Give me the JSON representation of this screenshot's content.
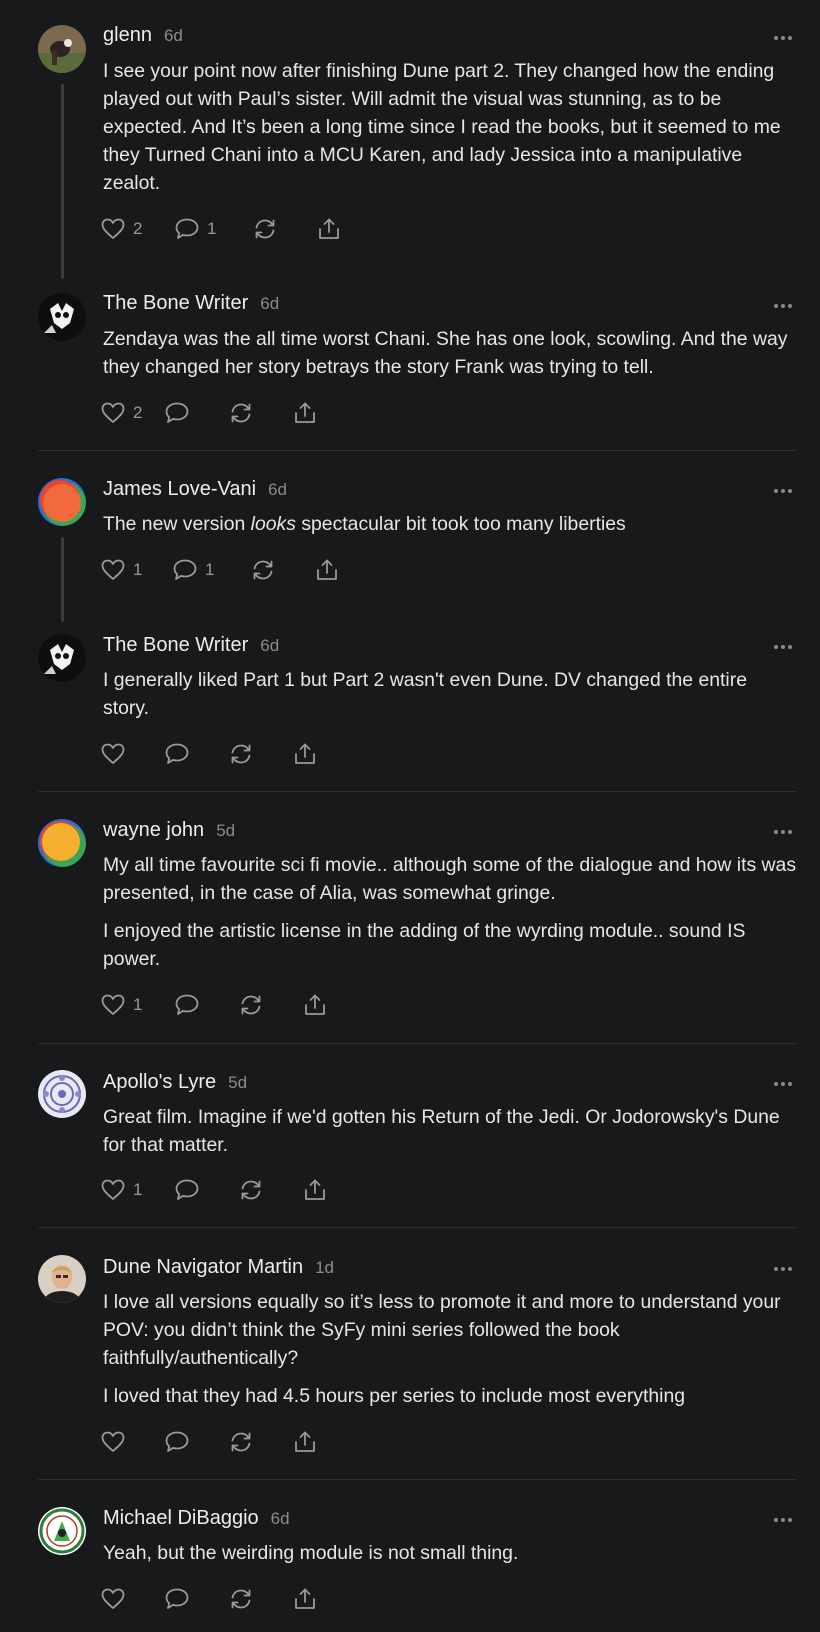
{
  "comments": [
    {
      "author": "glenn",
      "age": "6d",
      "paragraphs": [
        "I see your point now after finishing Dune part 2. They changed how the ending played out with Paul’s sister. Will admit the visual was stunning, as to be expected. And It’s been a long time since I read the books, but it seemed to me they Turned Chani into a MCU Karen, and lady Jessica into a manipulative zealot."
      ],
      "likes": "2",
      "replies": "1"
    },
    {
      "author": "The Bone Writer",
      "age": "6d",
      "paragraphs": [
        "Zendaya was the all time worst Chani. She has one look, scowling. And the way they changed her story betrays the story Frank was trying to tell."
      ],
      "likes": "2",
      "replies": ""
    },
    {
      "author": "James Love-Vani",
      "age": "6d",
      "para_pre": "The new version ",
      "para_em": "looks",
      "para_post": " spectacular bit took too many liberties",
      "likes": "1",
      "replies": "1"
    },
    {
      "author": "The Bone Writer",
      "age": "6d",
      "paragraphs": [
        "I generally liked Part 1 but Part 2 wasn't even Dune. DV changed the entire story."
      ],
      "likes": "",
      "replies": ""
    },
    {
      "author": "wayne john",
      "age": "5d",
      "paragraphs": [
        "My all time favourite sci fi movie.. although some of the dialogue and how its was presented, in the case of Alia, was somewhat gringe.",
        "I enjoyed the artistic license in the adding of the wyrding module.. sound IS power."
      ],
      "likes": "1",
      "replies": ""
    },
    {
      "author": "Apollo's Lyre",
      "age": "5d",
      "paragraphs": [
        "Great film. Imagine if we'd gotten his Return of the Jedi. Or Jodorowsky's Dune for that matter."
      ],
      "likes": "1",
      "replies": ""
    },
    {
      "author": "Dune Navigator Martin",
      "age": "1d",
      "paragraphs": [
        "I love all versions equally so it’s less to promote it and more to understand your POV: you didn’t think the SyFy mini series followed the book faithfully/authentically?",
        "I loved that they had 4.5 hours per series to include most everything"
      ],
      "likes": "",
      "replies": ""
    },
    {
      "author": "Michael DiBaggio",
      "age": "6d",
      "paragraphs": [
        "Yeah, but the weirding module is not small thing."
      ],
      "likes": "",
      "replies": ""
    }
  ]
}
